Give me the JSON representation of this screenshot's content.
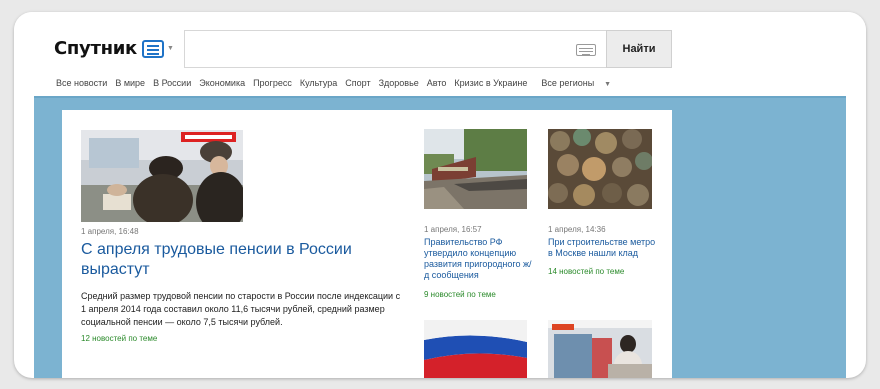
{
  "header": {
    "logo_text": "Спутник",
    "search": {
      "value": "",
      "placeholder": ""
    },
    "search_button": "Найти",
    "nav": [
      "Все новости",
      "В мире",
      "В России",
      "Экономика",
      "Прогресс",
      "Культура",
      "Спорт",
      "Здоровье",
      "Авто",
      "Кризис в Украине",
      "Все регионы"
    ]
  },
  "lead": {
    "date": "1 апреля, 16:48",
    "title": "С апреля трудовые пенсии в России вырастут",
    "text": "Средний размер трудовой пенсии по старости в России после индексации с 1 апреля 2014 года составил около 11,6 тысячи рублей, средний размер социальной пенсии — около 7,5 тысячи рублей.",
    "more": "12 новостей по теме"
  },
  "side_news": [
    {
      "date": "1 апреля, 16:57",
      "title": "Правительство РФ утвердило концепцию развития пригородного ж/д сообщения",
      "more": "9 новостей по теме"
    },
    {
      "date": "1 апреля, 14:36",
      "title": "При строительстве метро в Москве нашли клад",
      "more": "14 новостей по теме"
    }
  ],
  "colors": {
    "link": "#1a5a9e",
    "content_bg": "#7cb3d1",
    "more_link": "#2a8a2a"
  }
}
